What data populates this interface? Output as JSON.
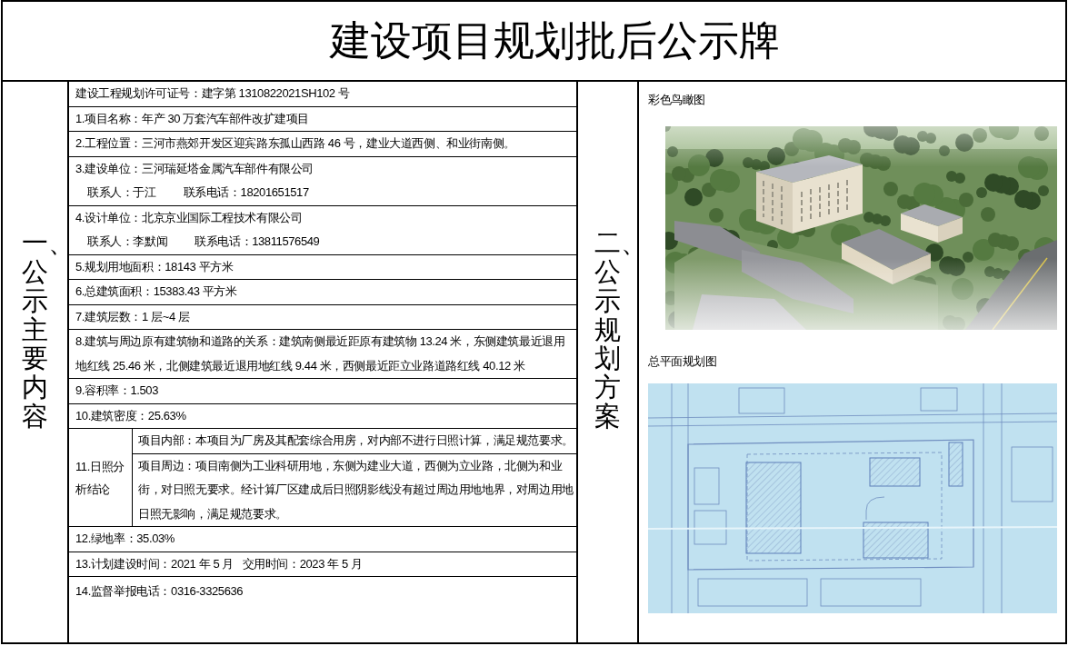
{
  "title": "建设项目规划批后公示牌",
  "main_content": {
    "heading": "一、公示主要内容",
    "rows": [
      {
        "kind": "text",
        "text": "建设工程规划许可证号：建字第 1310822021SH102 号"
      },
      {
        "kind": "text",
        "text": "1.项目名称：年产 30 万套汽车部件改扩建项目"
      },
      {
        "kind": "text",
        "text": "2.工程位置：三河市燕郊开发区迎宾路东孤山西路 46 号，建业大道西侧、和业街南侧。"
      },
      {
        "kind": "contact",
        "text": "3.建设单位：三河瑞延塔金属汽车部件有限公司",
        "contact_person": "联系人：于江",
        "contact_phone": "联系电话：18201651517"
      },
      {
        "kind": "contact",
        "text": "4.设计单位：北京京业国际工程技术有限公司",
        "contact_person": "联系人：李默闻",
        "contact_phone": "联系电话：13811576549"
      },
      {
        "kind": "text",
        "text": "5.规划用地面积：18143 平方米"
      },
      {
        "kind": "text",
        "text": "6.总建筑面积：15383.43 平方米"
      },
      {
        "kind": "text",
        "text": "7.建筑层数：1 层~4 层"
      },
      {
        "kind": "text",
        "text": "8.建筑与周边原有建筑物和道路的关系：建筑南侧最近距原有建筑物 13.24 米，东侧建筑最近退用地红线 25.46 米，北侧建筑最近退用地红线 9.44 米，西侧最近距立业路道路红线 40.12 米"
      },
      {
        "kind": "text",
        "text": "9.容积率：1.503"
      },
      {
        "kind": "text",
        "text": "10.建筑密度：25.63%"
      },
      {
        "kind": "split",
        "label": "11.日照分析结论",
        "items": [
          "项目内部：本项目为厂房及其配套综合用房，对内部不进行日照计算，满足规范要求。",
          "项目周边：项目南侧为工业科研用地，东侧为建业大道，西侧为立业路，北侧为和业街，对日照无要求。经计算厂区建成后日照阴影线没有超过周边用地地界，对周边用地日照无影响，满足规范要求。"
        ]
      },
      {
        "kind": "text",
        "text": "12.绿地率：35.03%"
      },
      {
        "kind": "text",
        "text": "13.计划建设时间：2021 年 5 月   交用时间：2023 年 5 月"
      },
      {
        "kind": "text",
        "text": "14.监督举报电话：0316-3325636"
      }
    ]
  },
  "plan": {
    "heading": "二、公示规划方案",
    "figures": [
      {
        "kind": "aerial",
        "caption": "彩色鸟瞰图"
      },
      {
        "kind": "site_plan",
        "caption": "总平面规划图"
      }
    ]
  }
}
